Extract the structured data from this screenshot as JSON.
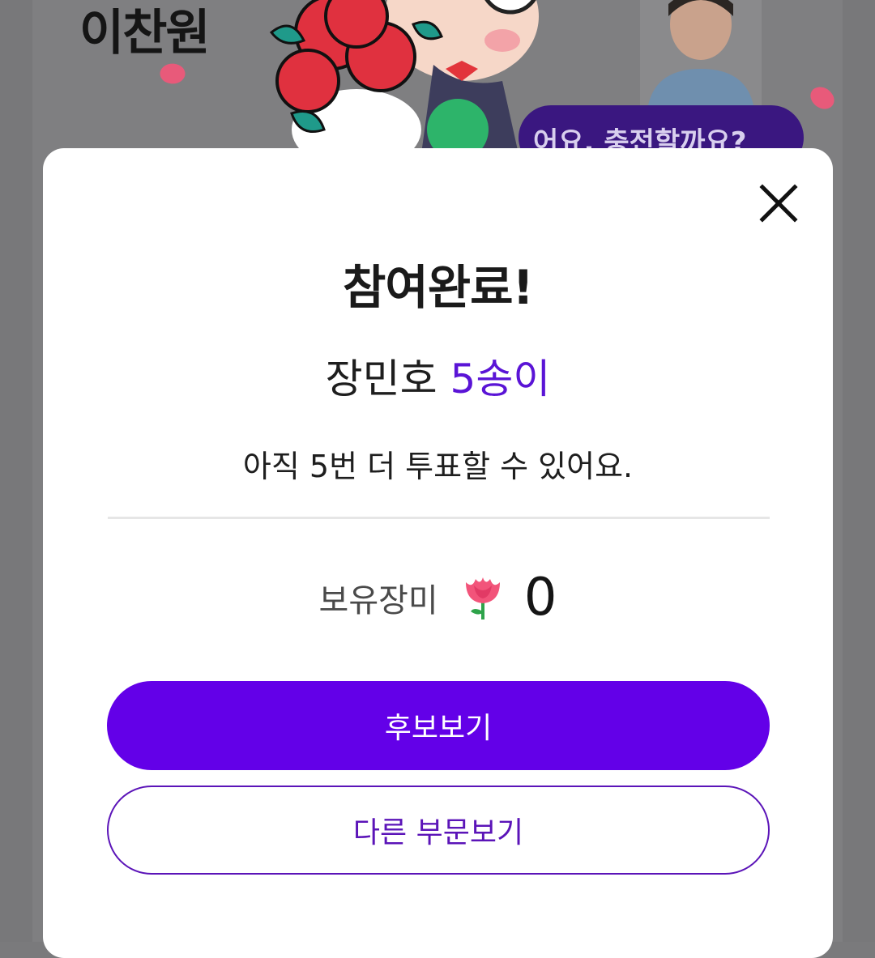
{
  "background": {
    "candidate_name": "이찬원",
    "bubble_text": "어요. 충전할까요?"
  },
  "modal": {
    "title": "참여완료!",
    "candidate_name": "장민호",
    "vote_count": "5송이",
    "remaining_text": "아직 5번 더 투표할 수 있어요.",
    "balance_label": "보유장미",
    "balance_icon": "rose-icon",
    "balance_value": "0",
    "primary_button": "후보보기",
    "secondary_button": "다른 부문보기",
    "close_icon": "close-icon"
  },
  "colors": {
    "accent": "#6300e8",
    "accent_text": "#5a14d6",
    "outline": "#5b14b8"
  }
}
